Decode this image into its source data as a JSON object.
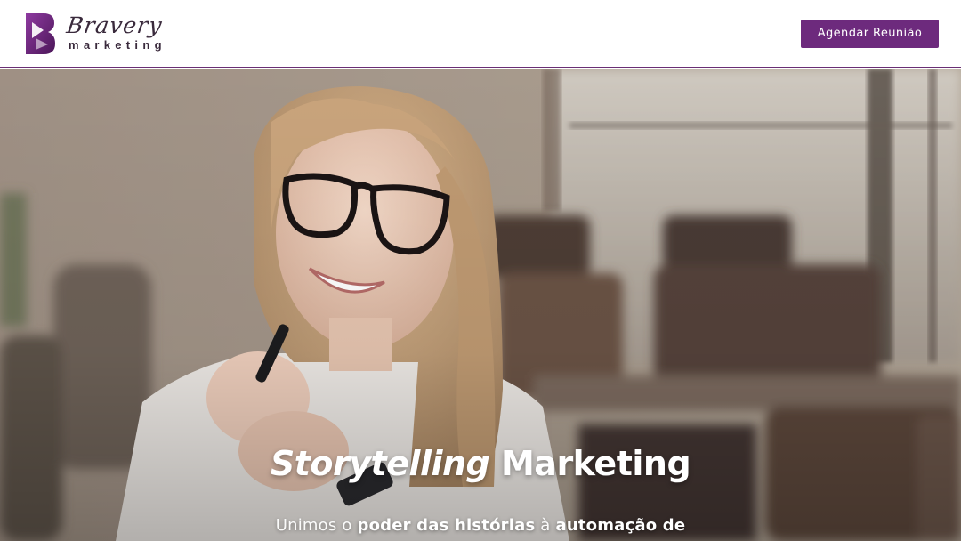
{
  "header": {
    "logo_script": "Bravery",
    "logo_sub": "marketing",
    "cta_label": "Agendar Reunião"
  },
  "hero": {
    "title_italic": "Storytelling",
    "title_regular": "Marketing",
    "subtitle_parts": [
      "Unimos o ",
      "poder das histórias",
      " à ",
      "automação de"
    ]
  },
  "colors": {
    "brand_purple": "#6d2a7d",
    "header_border": "#6a2f74",
    "text_white": "#ffffff"
  },
  "icons": [
    "bravery-logo-icon"
  ]
}
